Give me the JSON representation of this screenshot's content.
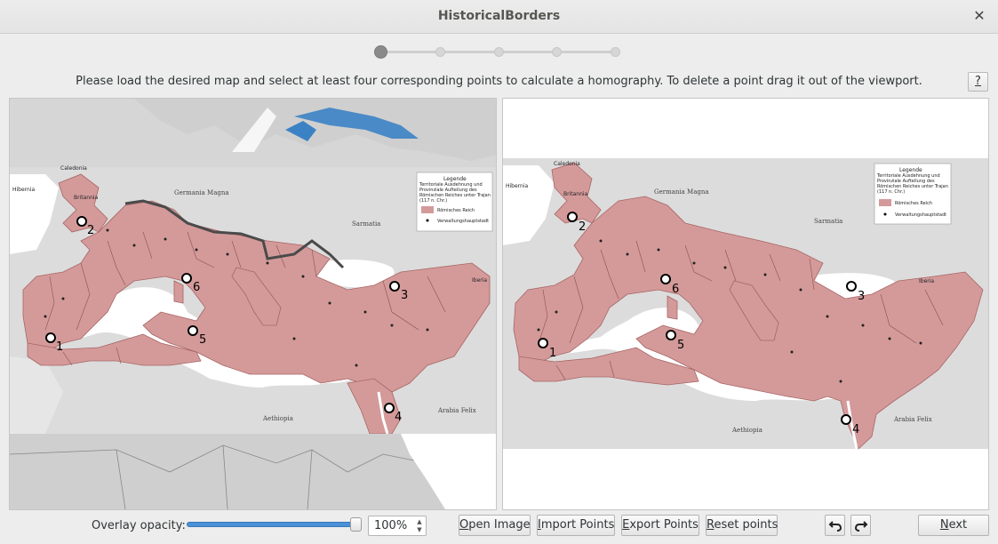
{
  "window": {
    "title": "HistoricalBorders",
    "close_icon": "close-icon"
  },
  "stepper": {
    "steps": 5,
    "current": 1
  },
  "instruction": "Please load the desired map and select at least four corresponding points to calculate a homography. To delete a point drag it out of the viewport.",
  "help_label": "?",
  "left_map": {
    "labels": {
      "caledonia": "Caledonia",
      "hibernia": "Hibernia",
      "britannia": "Britannia",
      "germania_magna": "Germania Magna",
      "sarmatia": "Sarmatia",
      "aethiopia": "Aethiopia",
      "arabia_felix": "Arabia Felix",
      "iberia": "Iberia"
    },
    "legend": {
      "title": "Legende",
      "body": "Territoriale Ausdehnung und Provinziale Aufteilung des Römischen Reiches unter Trajan (117 n. Chr.)",
      "item_empire": "Römisches Reich",
      "item_capital": "Verwaltungshauptstadt"
    },
    "points": [
      "1",
      "2",
      "3",
      "4",
      "5",
      "6"
    ]
  },
  "right_map": {
    "labels": {
      "caledonia": "Caledonia",
      "hibernia": "Hibernia",
      "britannia": "Britannia",
      "germania_magna": "Germania Magna",
      "sarmatia": "Sarmatia",
      "aethiopia": "Aethiopia",
      "arabia_felix": "Arabia Felix",
      "iberia": "Iberia"
    },
    "legend": {
      "title": "Legende",
      "body": "Territoriale Ausdehnung und Provinziale Aufteilung des Römischen Reiches unter Trajan (117 n. Chr.)",
      "item_empire": "Römisches Reich",
      "item_capital": "Verwaltungshauptstadt"
    },
    "points": [
      "1",
      "2",
      "3",
      "4",
      "5",
      "6"
    ]
  },
  "bottom": {
    "opacity_label": "Overlay opacity:",
    "opacity_value": "100%",
    "opacity_level": 1.0,
    "open_image": {
      "mnemonic": "O",
      "rest": "pen Image"
    },
    "import_points": {
      "mnemonic": "I",
      "rest": "mport Points"
    },
    "export_points": {
      "mnemonic": "E",
      "rest": "xport Points"
    },
    "reset_points": {
      "mnemonic": "R",
      "rest": "eset points"
    },
    "undo_icon": "undo-icon",
    "redo_icon": "redo-icon",
    "next": {
      "mnemonic": "N",
      "rest": "ext"
    }
  },
  "colors": {
    "empire": "#d49a9a",
    "empire_stroke": "#a86464",
    "water": "#3b82c4",
    "land": "#d9d9d9",
    "accent": "#4a90d9"
  }
}
